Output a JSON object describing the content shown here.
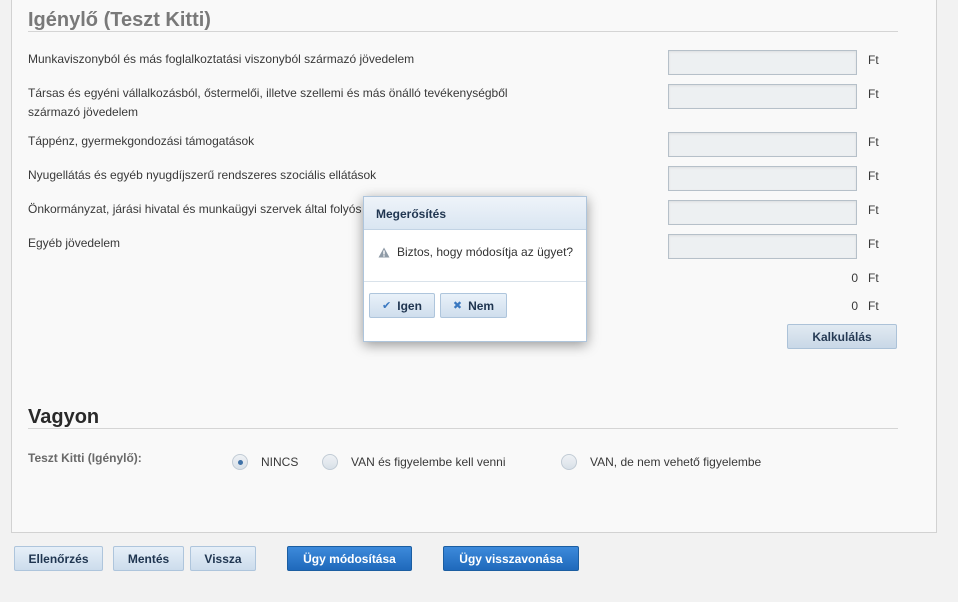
{
  "applicant": {
    "title": "Igénylő (Teszt Kitti)",
    "currency": "Ft",
    "rows": [
      {
        "label": "Munkaviszonyból és más foglalkoztatási viszonyból származó jövedelem",
        "value": ""
      },
      {
        "label": "Társas és egyéni vállalkozásból, őstermelői, illetve szellemi és más önálló tevékenységből származó jövedelem",
        "value": ""
      },
      {
        "label": "Táppénz, gyermekgondozási támogatások",
        "value": ""
      },
      {
        "label": "Nyugellátás és egyéb nyugdíjszerű rendszeres szociális ellátások",
        "value": ""
      },
      {
        "label": "Önkormányzat, járási hivatal és munkaügyi szervek által folyós",
        "value": ""
      },
      {
        "label": "Egyéb jövedelem",
        "value": ""
      }
    ],
    "sum1": "0",
    "sum2": "0",
    "calc_label": "Kalkulálás"
  },
  "assets": {
    "title": "Vagyon",
    "owner_label": "Teszt Kitti (Igénylő):",
    "options": [
      {
        "label": "NINCS",
        "checked": true
      },
      {
        "label": "VAN és figyelembe kell venni",
        "checked": false
      },
      {
        "label": "VAN, de nem vehető figyelembe",
        "checked": false
      }
    ]
  },
  "footer": {
    "check": "Ellenőrzés",
    "save": "Mentés",
    "back": "Vissza",
    "modify": "Ügy módosítása",
    "withdraw": "Ügy visszavonása"
  },
  "dialog": {
    "title": "Megerősítés",
    "message": "Biztos, hogy módosítja az ügyet?",
    "yes": "Igen",
    "no": "Nem"
  },
  "colors": {
    "primary": "#1f69bb",
    "accent": "#3a78c0"
  }
}
